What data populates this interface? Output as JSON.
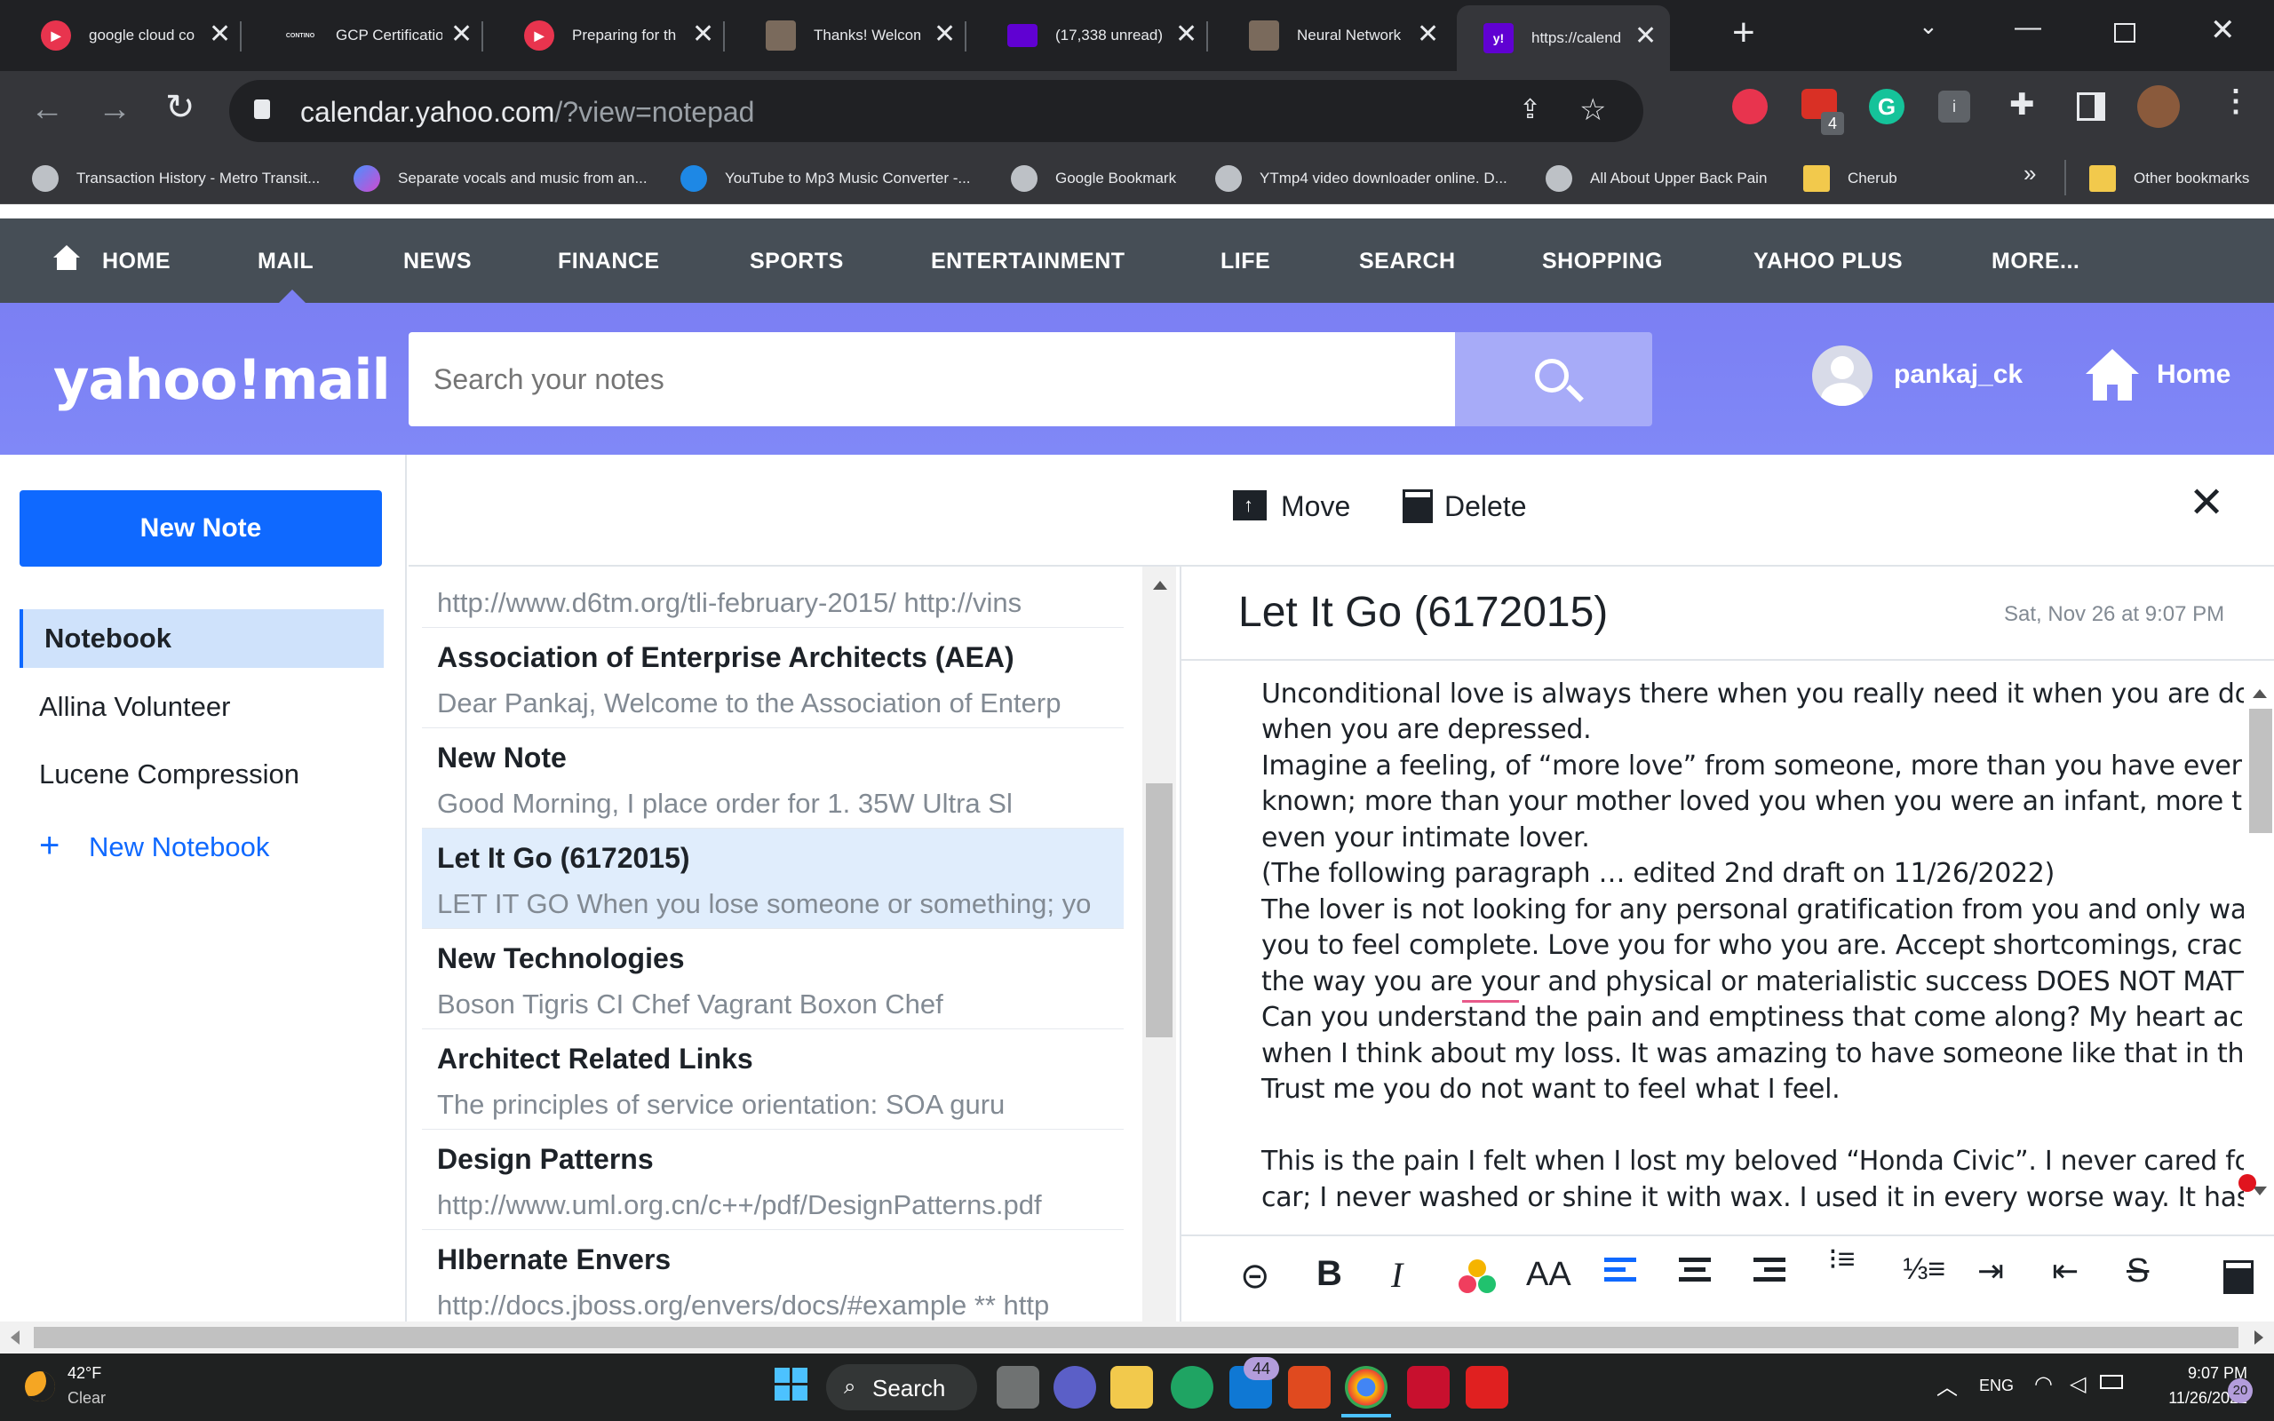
{
  "browser": {
    "tabs": [
      {
        "title": "google cloud co",
        "icon": "red-play-icon"
      },
      {
        "title": "GCP Certificatio",
        "icon": "contino-logo-icon",
        "favicon_text": "CONTINO"
      },
      {
        "title": "Preparing for th",
        "icon": "red-play-icon"
      },
      {
        "title": "Thanks! Welcom",
        "icon": "portrait-icon"
      },
      {
        "title": "(17,338 unread)",
        "icon": "yahoo-envelope-icon"
      },
      {
        "title": "Neural Network",
        "icon": "portrait-icon"
      },
      {
        "title": "https://calendar",
        "icon": "yahoo-y-icon",
        "favicon_text": "y!"
      }
    ],
    "url_host": "calendar.yahoo.com",
    "url_path": "/?view=notepad",
    "extension_badge": "4",
    "extension_i": "i",
    "bookmarks": [
      "Transaction History - Metro Transit...",
      "Separate vocals and music from an...",
      "YouTube to Mp3 Music Converter -...",
      "Google Bookmark",
      "YTmp4 video downloader online. D...",
      "All About Upper Back Pain",
      "Cherub"
    ],
    "other_bookmarks": "Other bookmarks",
    "more_bookmarks": "»"
  },
  "yahoo_nav": [
    "HOME",
    "MAIL",
    "NEWS",
    "FINANCE",
    "SPORTS",
    "ENTERTAINMENT",
    "LIFE",
    "SEARCH",
    "SHOPPING",
    "YAHOO PLUS",
    "MORE..."
  ],
  "header": {
    "logo": "yahoo!mail",
    "search_placeholder": "Search your notes",
    "username": "pankaj_ck",
    "home_label": "Home"
  },
  "sidebar": {
    "new_note": "New Note",
    "notebooks": [
      "Notebook",
      "Allina Volunteer",
      "Lucene Compression"
    ],
    "new_notebook": "New Notebook"
  },
  "toolbar": {
    "move": "Move",
    "delete": "Delete"
  },
  "notes": [
    {
      "title": "",
      "preview": "http://www.d6tm.org/tli-february-2015/ http://vins"
    },
    {
      "title": "Association of Enterprise Architects (AEA)",
      "preview": "Dear Pankaj, Welcome to the Association of Enterp"
    },
    {
      "title": "New Note",
      "preview": "Good Morning, I place order for 1. 35W Ultra Sl"
    },
    {
      "title": "Let It Go (6172015)",
      "preview": "LET IT GO When you lose someone or something; yo"
    },
    {
      "title": "New Technologies",
      "preview": "Boson Tigris CI Chef Vagrant Boxon Chef"
    },
    {
      "title": "Architect Related Links",
      "preview": "The principles of service orientation: SOA guru"
    },
    {
      "title": "Design Patterns",
      "preview": "http://www.uml.org.cn/c++/pdf/DesignPatterns.pdf"
    },
    {
      "title": "HIbernate Envers",
      "preview": "http://docs.jboss.org/envers/docs/#example ** http"
    }
  ],
  "editor": {
    "title": "Let It Go (6172015)",
    "date": "Sat, Nov 26 at 9:07 PM",
    "lines": [
      "Unconditional love is always there when you really need it when you are down",
      "when you are depressed.",
      "Imagine a feeling, of “more love” from someone, more than you have ever",
      "known; more than your mother loved you when you were an infant, more than",
      "even your intimate lover.",
      "(The following paragraph … edited 2nd draft on 11/26/2022)",
      "The lover is not looking for any personal gratification from you and only wants",
      "you to feel complete. Love you for who you are.  Accept shortcomings, cracks,",
      "the way you are your and physical or materialistic success DOES NOT MATTER.",
      "Can you understand the pain and emptiness that come along? My heart aches",
      "when I think about my loss. It was amazing to have someone like that in this life.",
      "Trust me you do not want to feel what I feel.",
      "",
      "This is the pain I felt when I lost my beloved “Honda Civic”. I never cared for this",
      "car; I never washed or shine it with wax. I used it in every worse way. It has been"
    ]
  },
  "taskbar": {
    "weather_temp": "42°F",
    "weather_desc": "Clear",
    "search": "Search",
    "mail_badge": "44",
    "lang": "ENG",
    "time": "9:07 PM",
    "date": "11/26/2022",
    "notif_count": "20"
  }
}
